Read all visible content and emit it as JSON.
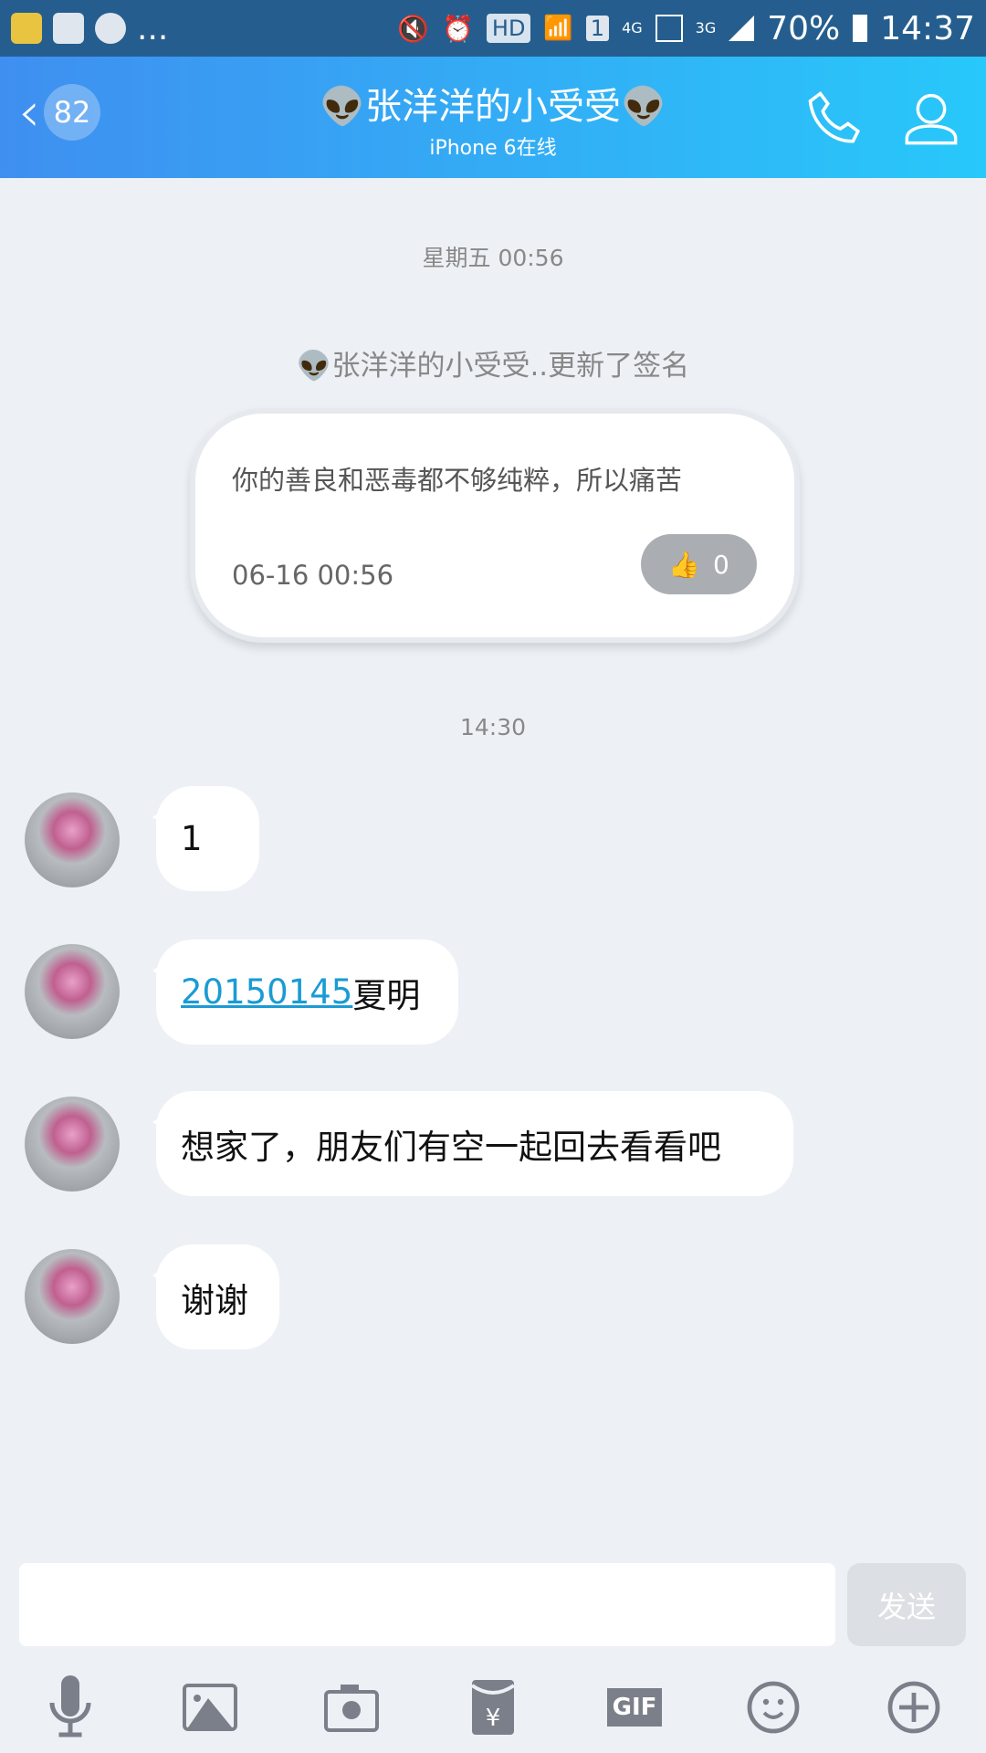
{
  "status_bar": {
    "more": "...",
    "hd": "HD",
    "sim": "1",
    "net1": "4G",
    "net2": "3G",
    "battery": "70%",
    "time": "14:37"
  },
  "header": {
    "unread_count": "82",
    "title": "👽张洋洋的小受受👽",
    "subtitle": "iPhone 6在线"
  },
  "chat": {
    "timestamp1": "星期五 00:56",
    "signature_notice": "👽张洋洋的小受受..更新了签名",
    "signature_card": {
      "text": "你的善良和恶毒都不够纯粹，所以痛苦",
      "date": "06-16 00:56",
      "likes": "0"
    },
    "timestamp2": "14:30",
    "messages": [
      {
        "text": "1"
      },
      {
        "link": "20150145",
        "text": "夏明"
      },
      {
        "text": "想家了，朋友们有空一起回去看看吧"
      },
      {
        "text": "谢谢"
      }
    ]
  },
  "composer": {
    "input_value": "",
    "send_label": "发送",
    "gif_label": "GIF"
  }
}
